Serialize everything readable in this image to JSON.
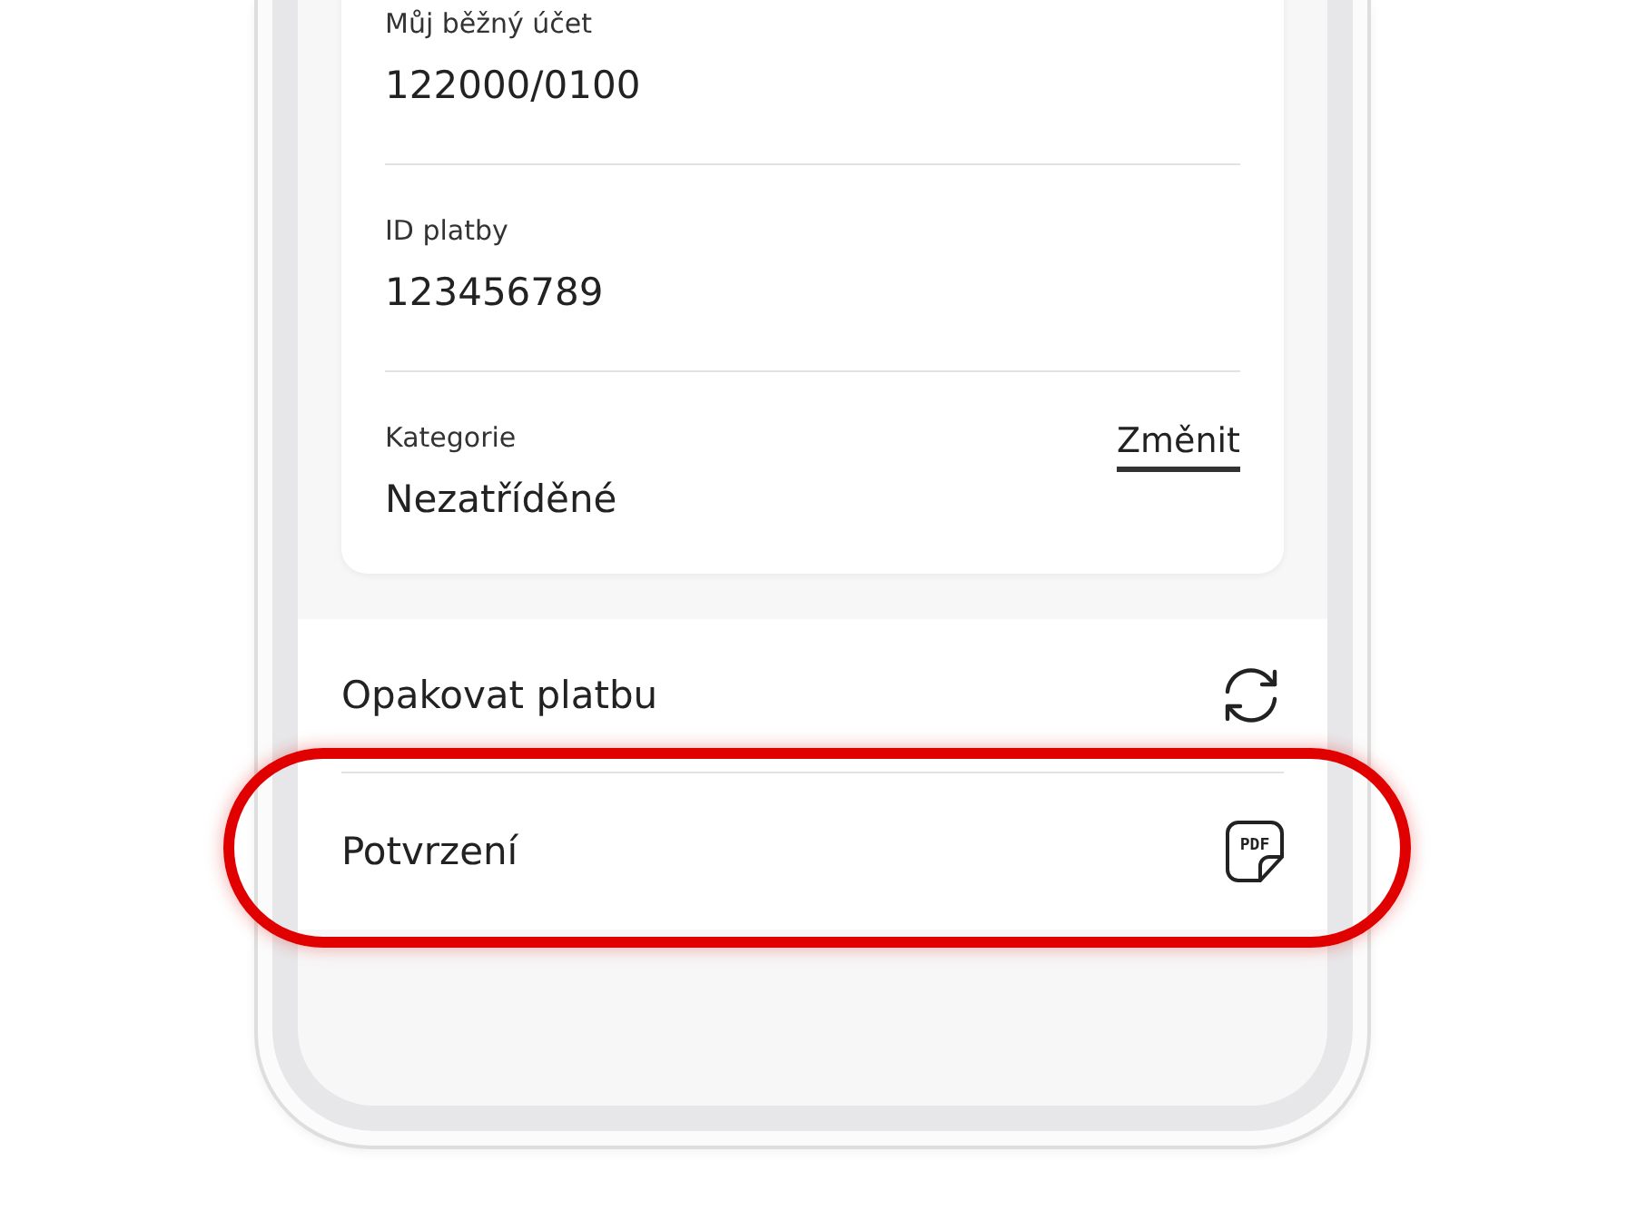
{
  "details": [
    {
      "label": "Můj běžný účet",
      "value": "122000/0100"
    },
    {
      "label": "ID platby",
      "value": "123456789"
    },
    {
      "label": "Kategorie",
      "value": "Nezatříděné",
      "action": "Změnit"
    }
  ],
  "actions": [
    {
      "label": "Opakovat platbu",
      "kind": "repeat",
      "highlighted": false
    },
    {
      "label": "Potvrzení",
      "kind": "pdf",
      "icon_text": "PDF",
      "highlighted": true
    }
  ]
}
